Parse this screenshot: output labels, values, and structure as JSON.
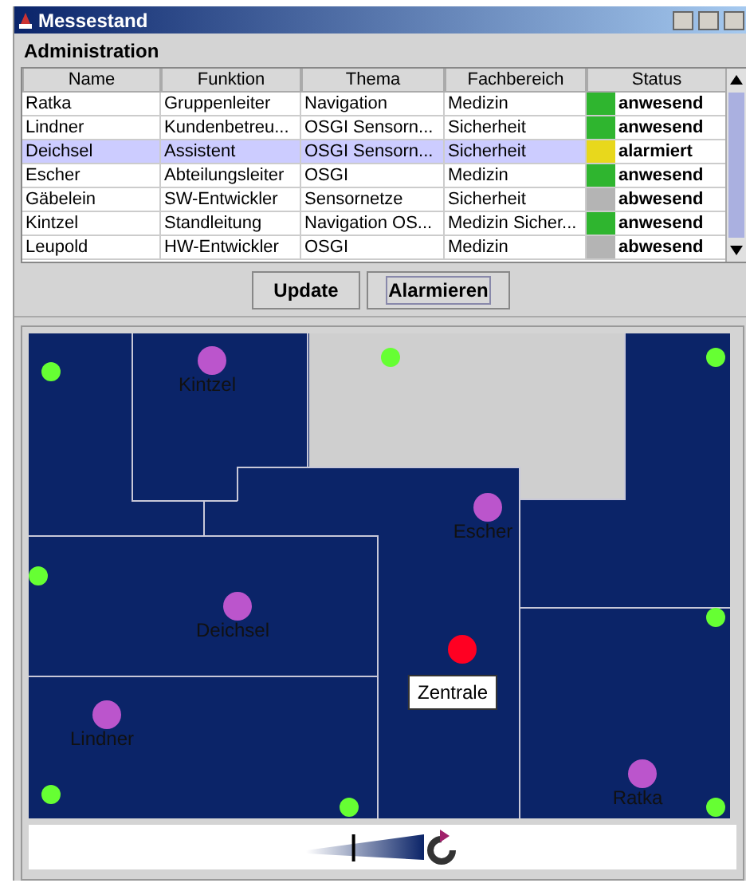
{
  "window": {
    "title": "Messestand"
  },
  "section_title": "Administration",
  "table": {
    "columns": [
      "Name",
      "Funktion",
      "Thema",
      "Fachbereich",
      "Status"
    ],
    "rows": [
      {
        "name": "Ratka",
        "function": "Gruppenleiter",
        "topic": "Navigation",
        "field": "Medizin",
        "status": "anwesend",
        "color": "#2fb52f",
        "selected": false
      },
      {
        "name": "Lindner",
        "function": "Kundenbetreu...",
        "topic": "OSGI Sensorn...",
        "field": "Sicherheit",
        "status": "anwesend",
        "color": "#2fb52f",
        "selected": false
      },
      {
        "name": "Deichsel",
        "function": "Assistent",
        "topic": "OSGI Sensorn...",
        "field": "Sicherheit",
        "status": "alarmiert",
        "color": "#e8d81c",
        "selected": true
      },
      {
        "name": "Escher",
        "function": "Abteilungsleiter",
        "topic": "OSGI",
        "field": "Medizin",
        "status": "anwesend",
        "color": "#2fb52f",
        "selected": false
      },
      {
        "name": "Gäbelein",
        "function": "SW-Entwickler",
        "topic": "Sensornetze",
        "field": "Sicherheit",
        "status": "abwesend",
        "color": "#b4b4b4",
        "selected": false
      },
      {
        "name": "Kintzel",
        "function": "Standleitung",
        "topic": "Navigation OS...",
        "field": "Medizin Sicher...",
        "status": "anwesend",
        "color": "#2fb52f",
        "selected": false
      },
      {
        "name": "Leupold",
        "function": "HW-Entwickler",
        "topic": "OSGI",
        "field": "Medizin",
        "status": "abwesend",
        "color": "#b4b4b4",
        "selected": false
      }
    ]
  },
  "buttons": [
    {
      "label": "Update",
      "focused": false
    },
    {
      "label": "Alarmieren",
      "focused": true
    }
  ],
  "map": {
    "people": [
      {
        "name": "Kintzel"
      },
      {
        "name": "Escher"
      },
      {
        "name": "Deichsel"
      },
      {
        "name": "Lindner"
      },
      {
        "name": "Ratka"
      }
    ],
    "center": {
      "label": "Zentrale"
    },
    "zoom": {
      "level": 0.4
    }
  }
}
